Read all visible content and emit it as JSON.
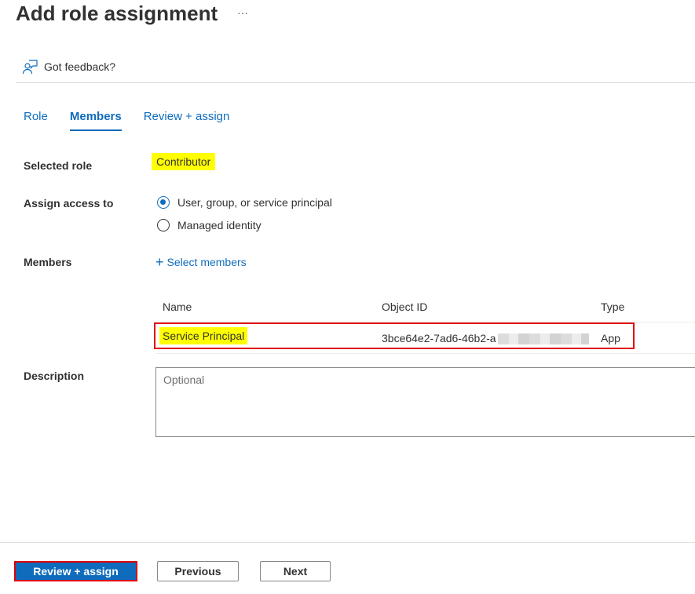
{
  "header": {
    "title": "Add role assignment",
    "more_label": "···",
    "feedback_label": "Got feedback?"
  },
  "tabs": [
    {
      "label": "Role",
      "active": false
    },
    {
      "label": "Members",
      "active": true
    },
    {
      "label": "Review + assign",
      "active": false
    }
  ],
  "form": {
    "selected_role_label": "Selected role",
    "selected_role_value": "Contributor",
    "assign_access_label": "Assign access to",
    "assign_options": [
      {
        "label": "User, group, or service principal",
        "selected": true
      },
      {
        "label": "Managed identity",
        "selected": false
      }
    ],
    "members_label": "Members",
    "select_members_label": "Select members",
    "members_table": {
      "columns": [
        "Name",
        "Object ID",
        "Type"
      ],
      "rows": [
        {
          "name": "Service Principal",
          "object_id": "3bce64e2-7ad6-46b2-a",
          "type": "App"
        }
      ]
    },
    "description_label": "Description",
    "description_placeholder": "Optional",
    "description_value": ""
  },
  "footer": {
    "review_assign_label": "Review + assign",
    "previous_label": "Previous",
    "next_label": "Next"
  },
  "colors": {
    "accent": "#0f6cbd",
    "highlight": "#ffff00",
    "annotation_border": "#e00000"
  }
}
